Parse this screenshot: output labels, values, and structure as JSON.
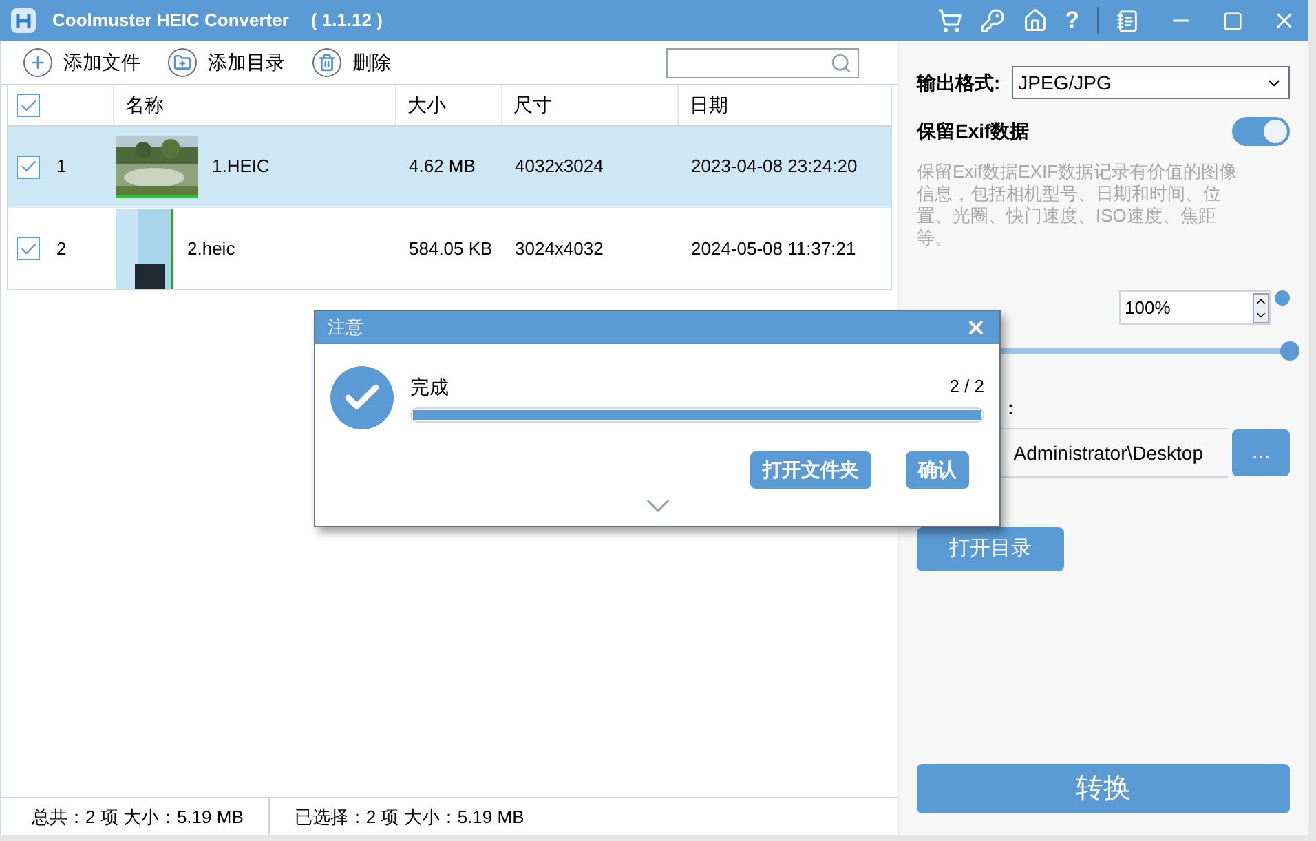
{
  "window": {
    "title": "Coolmuster HEIC Converter",
    "version": "( 1.1.12 )",
    "help": "?"
  },
  "toolbar": [
    {
      "label": "添加文件",
      "kind": "file"
    },
    {
      "label": "添加目录",
      "kind": "folder"
    },
    {
      "label": "删除",
      "kind": "delete"
    }
  ],
  "table": {
    "select_all": {
      "checked": true
    },
    "columns": [
      "名称",
      "大小",
      "尺寸",
      "日期"
    ],
    "rows": [
      {
        "index": "1",
        "name": "1.HEIC",
        "size": "4.62 MB",
        "dimensions": "4032x3024",
        "date": "2023-04-08 23:24:20",
        "checked": true,
        "selected": true
      },
      {
        "index": "2",
        "name": "2.heic",
        "size": "584.05 KB",
        "dimensions": "3024x4032",
        "date": "2024-05-08 11:37:21",
        "checked": true,
        "selected": false
      }
    ]
  },
  "settings": {
    "format_label": "输出格式:",
    "format": "JPEG/JPG",
    "exif_label": "保留Exif数据",
    "exif_on": true,
    "exif_description": "保留Exif数据EXIF数据记录有价值的图像信息，包括相机型号、日期和时间、位置、光圈、快门速度、ISO速度、焦距等。",
    "quality": {
      "value": "100%",
      "level": 1
    },
    "output_label_fragment": ":",
    "output_path": "Administrator\\Desktop",
    "browse": "...",
    "open_folder": "打开目录",
    "convert": "转换"
  },
  "status_bar": [
    "总共：2 项 大小：5.19 MB",
    "已选择：2 项 大小：5.19 MB"
  ],
  "dialog": {
    "title": "注意",
    "status": "完成",
    "count": "2 / 2",
    "level": 1,
    "buttons": [
      "打开文件夹",
      "确认"
    ]
  }
}
